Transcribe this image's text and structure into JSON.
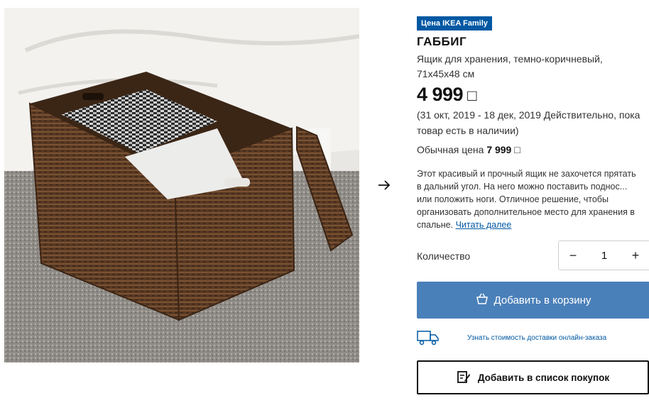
{
  "product": {
    "badge": "Цена IKEA Family",
    "name": "ГАББИГ",
    "description": "Ящик для хранения, темно-коричневый, 71x45x48 см",
    "price": "4 999",
    "currency_symbol": "□",
    "validity": "(31 окт, 2019 - 18 дек, 2019 Действительно, пока товар есть в наличии)",
    "regular_price_label": "Обычная цена",
    "regular_price": "7 999",
    "regular_currency_symbol": "□",
    "long_description": "Этот красивый и прочный ящик не захочется прятать в дальний угол. На него можно поставить поднос... или положить ноги. Отличное решение, чтобы организовать дополнительное место для хранения в спальне.",
    "read_more": "Читать далее"
  },
  "quantity": {
    "label": "Количество",
    "value": "1",
    "minus": "−",
    "plus": "+"
  },
  "actions": {
    "add_to_cart": "Добавить в корзину",
    "delivery_link": "Узнать стоимость доставки онлайн-заказа",
    "add_to_list": "Добавить в список покупок"
  },
  "icons": {
    "next": "arrow-right-icon",
    "cart": "shopping-bag-icon",
    "delivery": "truck-icon",
    "list": "edit-list-icon"
  },
  "colors": {
    "brand_blue": "#0058a3",
    "cart_button": "#4a80b9",
    "text": "#111111"
  }
}
